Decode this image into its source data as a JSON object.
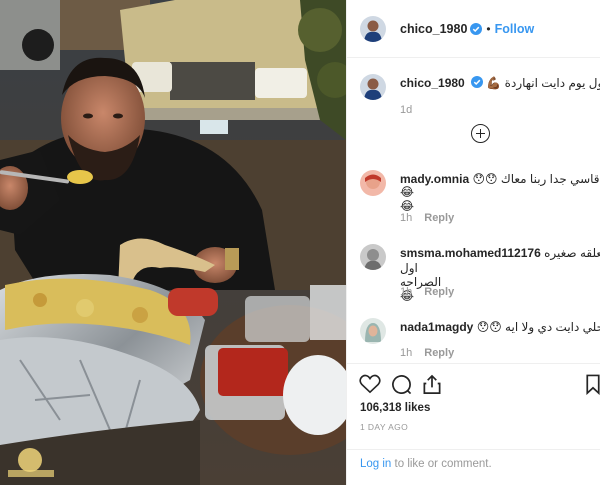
{
  "post": {
    "username": "chico_1980",
    "verified": true,
    "follow_label": "Follow",
    "separator": "•"
  },
  "caption": {
    "username": "chico_1980",
    "text": "‫اول يوم دايت انهاردة 💪🏾‬",
    "age": "1d"
  },
  "comments": [
    {
      "username": "mady.omnia",
      "text": "‫دايت قاسي جدا ربنا معاك 😯😯‬",
      "text2": "😂😂",
      "age": "1h",
      "reply": "Reply"
    },
    {
      "username": "smsma.mohamed112176",
      "text": "‫المعلقه صغيره‬",
      "text2": "‫اول الصراحه 😂‬",
      "age": "1h",
      "reply": "Reply"
    },
    {
      "username": "nada1magdy",
      "text": "‫احلي دايت دي ولا ايه 😯😯‬",
      "text2": "",
      "age": "1h",
      "reply": "Reply"
    }
  ],
  "icons": [
    "heart-icon",
    "comment-icon",
    "share-icon",
    "bookmark-icon",
    "load-more-icon",
    "verified-icon"
  ],
  "stats": {
    "likes": "106,318 likes",
    "date": "1 DAY AGO"
  },
  "login": {
    "link": "Log in",
    "rest": " to like or comment."
  },
  "colors": {
    "accent": "#3897f0",
    "text": "#262626",
    "muted": "#999999",
    "border": "#efefef"
  }
}
